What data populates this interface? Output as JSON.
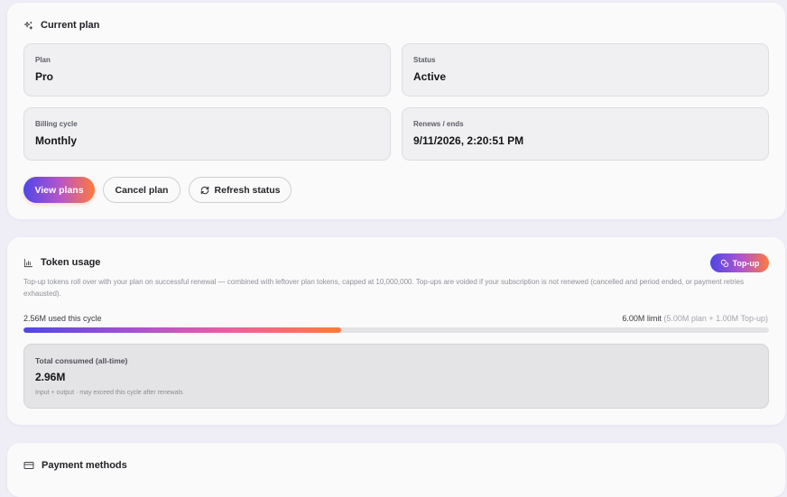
{
  "plan_card": {
    "title": "Current plan",
    "fields": [
      {
        "label": "Plan",
        "value": "Pro"
      },
      {
        "label": "Status",
        "value": "Active"
      },
      {
        "label": "Billing cycle",
        "value": "Monthly"
      },
      {
        "label": "Renews / ends",
        "value": "9/11/2026, 2:20:51 PM"
      }
    ],
    "buttons": {
      "view_plans": "View plans",
      "cancel_plan": "Cancel plan",
      "refresh_status": "Refresh status"
    }
  },
  "usage_card": {
    "title": "Token usage",
    "topup_label": "Top-up",
    "note": "Top-up tokens roll over with your plan on successful renewal — combined with leftover plan tokens, capped at 10,000,000. Top-ups are voided if your subscription is not renewed (cancelled and period ended, or payment retries exhausted).",
    "used_label": "2.56M used this cycle",
    "limit_label": "6.00M limit",
    "limit_detail": "(5.00M plan + 1.00M Top-up)",
    "progress_fraction": 0.4267,
    "consumed": {
      "label": "Total consumed (all-time)",
      "value": "2.96M",
      "hint": "Input + output · may exceed this cycle after renewals"
    }
  },
  "payment_card": {
    "title": "Payment methods"
  },
  "colors": {
    "gradient_start": "#4f46e5",
    "gradient_mid": "#b455c9",
    "gradient_end": "#ff7a3d",
    "card_bg": "#fafafa",
    "page_bg": "#efedf6"
  },
  "icons": {
    "plan": "sparkles-icon",
    "usage": "bar-chart-icon",
    "topup": "coins-icon",
    "refresh": "refresh-icon",
    "payment": "credit-card-icon"
  }
}
